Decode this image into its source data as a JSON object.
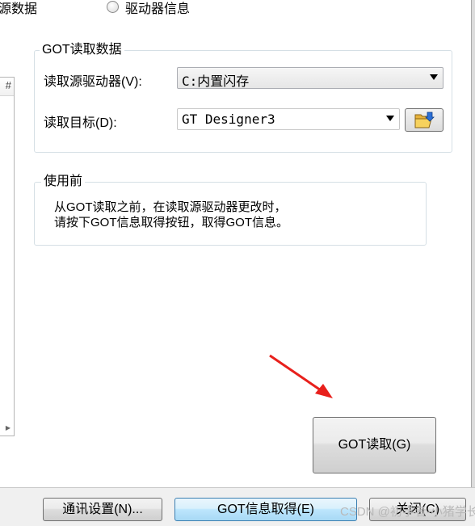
{
  "top_row": {
    "left_label": "源数据",
    "radio_label": "驱动器信息"
  },
  "left_panel": {
    "header_glyph": "#"
  },
  "got_read_data": {
    "title": "GOT读取数据",
    "source_drive_label": "读取源驱动器(V):",
    "source_drive_value": "C:内置闪存",
    "target_label": "读取目标(D):",
    "target_value": "GT Designer3",
    "browse_icon": "folder-open-icon"
  },
  "before_use": {
    "title": "使用前",
    "line1": "从GOT读取之前，在读取源驱动器更改时，",
    "line2": "请按下GOT信息取得按钮，取得GOT信息。"
  },
  "buttons": {
    "got_read": "GOT读取(G)",
    "comm_settings": "通讯设置(N)...",
    "got_info": "GOT信息取得(E)",
    "close": "关闭(C)"
  },
  "watermark": "CSDN @初学者-小猪学长",
  "colors": {
    "annotation_arrow": "#e8201c",
    "hot_button_border": "#3c7fb1"
  }
}
